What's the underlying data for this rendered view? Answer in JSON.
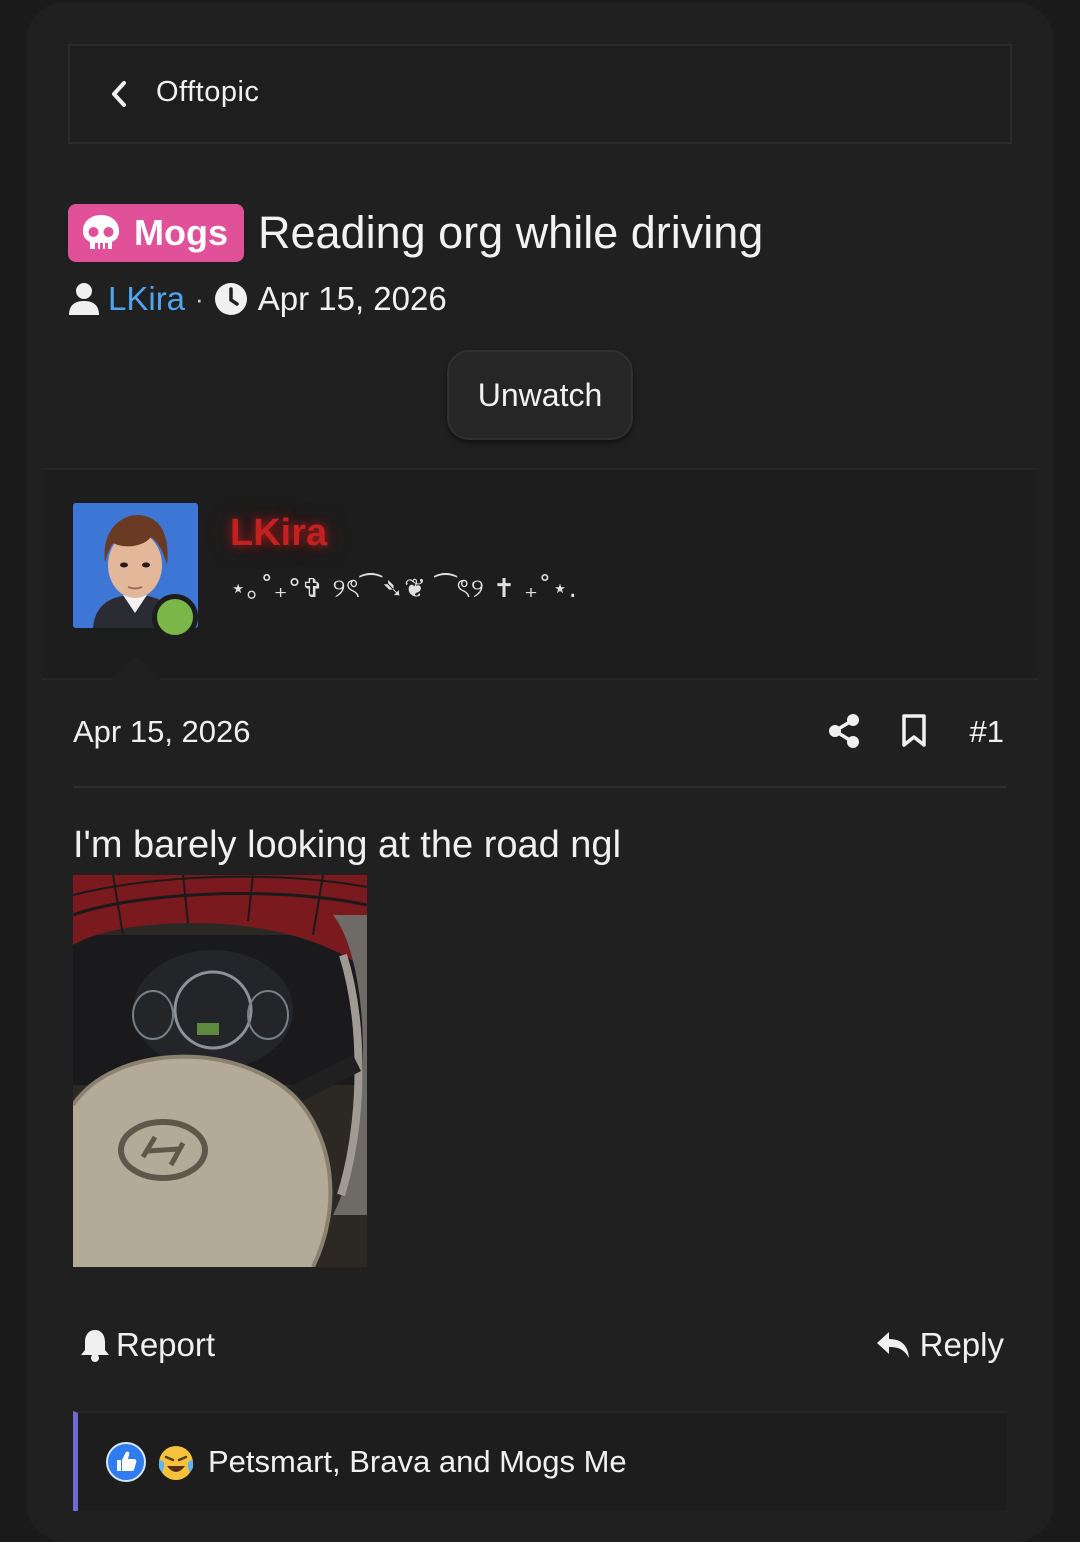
{
  "breadcrumb": {
    "label": "Offtopic"
  },
  "thread": {
    "prefix": "Mogs",
    "prefix_color": "#e0519a",
    "title": "Reading org while driving",
    "author": "LKira",
    "date": "Apr 15, 2026",
    "watch_button": "Unwatch"
  },
  "user_card": {
    "username": "LKira",
    "user_title": "⋆｡˚₊°✞ ୨ৎ⁀➴❦ ⁀ৎ୨ ✝ ₊˚⋆.",
    "status": "online"
  },
  "post": {
    "date": "Apr 15, 2026",
    "number": "#1",
    "text": "I'm barely looking at the road ngl",
    "attachment_icon": "steering-wheel-photo"
  },
  "actions": {
    "report": "Report",
    "reply": "Reply"
  },
  "reactions": {
    "text": "Petsmart, Brava and Mogs Me",
    "icons": [
      "like-icon",
      "laughing-crying-icon"
    ]
  },
  "colors": {
    "background": "#202020",
    "link": "#4fa3f0",
    "username_style": "#c42020",
    "online": "#7ab648",
    "reaction_accent": "#6f6ad0"
  }
}
